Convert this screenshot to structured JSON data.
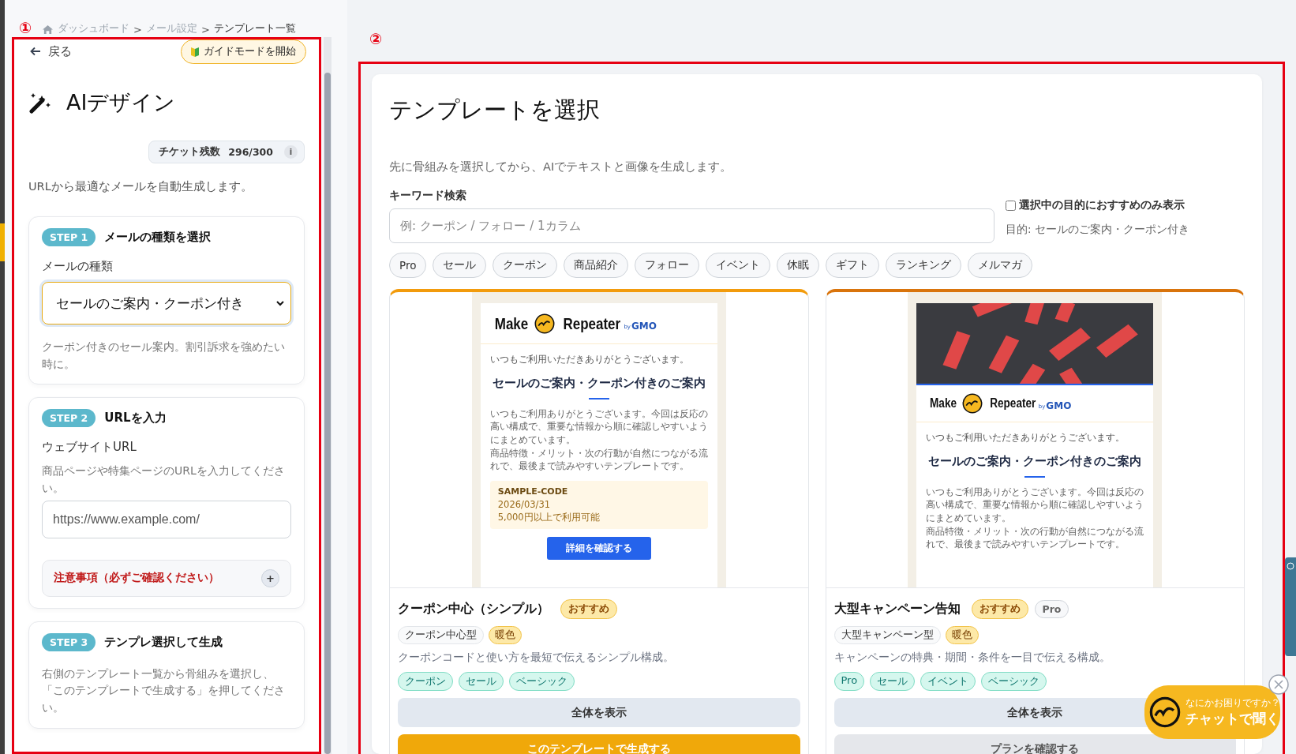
{
  "annotations": [
    {
      "label": "①"
    },
    {
      "label": "②"
    }
  ],
  "breadcrumb": {
    "separator": ">",
    "items": [
      {
        "label": "ダッシュボード",
        "current": false
      },
      {
        "label": "メール設定",
        "current": false
      },
      {
        "label": "テンプレート一覧",
        "current": true
      }
    ]
  },
  "sidebar": {
    "back": "戻る",
    "guide_button": "ガイドモードを開始",
    "title": "AIデザイン",
    "ticket": {
      "label": "チケット残数",
      "value": "296/300",
      "info": "i"
    },
    "intro": "URLから最適なメールを自動生成します。",
    "steps": [
      {
        "kind": "select",
        "badge": "STEP 1",
        "title": "メールの種類を選択",
        "field_label": "メールの種類",
        "value": "セールのご案内・クーポン付き",
        "note": "クーポン付きのセール案内。割引訴求を強めたい時に。"
      },
      {
        "kind": "url",
        "badge": "STEP 2",
        "title": "URLを入力",
        "field_label": "ウェブサイトURL",
        "note": "商品ページや特集ページのURLを入力してください。",
        "placeholder": "https://www.example.com/",
        "notice": {
          "label": "注意事項（必ずご確認ください）",
          "toggle": "+"
        }
      },
      {
        "kind": "text",
        "badge": "STEP 3",
        "title": "テンプレ選択して生成",
        "note": "右側のテンプレート一覧から骨組みを選択し、「このテンプレートで生成する」を押してください。"
      }
    ]
  },
  "main": {
    "title": "テンプレートを選択",
    "subtitle": "先に骨組みを選択してから、AIでテキストと画像を生成します。",
    "search_label": "キーワード検索",
    "search_placeholder": "例: クーポン / フォロー / 1カラム",
    "recommend_filter": {
      "label": "選択中の目的におすすめのみ表示",
      "checked": false
    },
    "purpose": "目的: セールのご案内・クーポン付き",
    "chips": [
      "Pro",
      "セール",
      "クーポン",
      "商品紹介",
      "フォロー",
      "イベント",
      "休眠",
      "ギフト",
      "ランキング",
      "メルマガ"
    ],
    "templates": [
      {
        "preview": {
          "kind": "logo-top",
          "logo": {
            "make": "Make",
            "repeater": "Repeater",
            "by": "by",
            "maker": "GMO"
          },
          "greeting": "いつもご利用いただきありがとうございます。",
          "headline": "セールのご案内・クーポン付きのご案内",
          "body": [
            "いつもご利用ありがとうございます。今回は反応の高い構成で、重要な情報から順に確認しやすいようにまとめています。",
            "商品特徴・メリット・次の行動が自然につながる流れで、最後まで読みやすいテンプレートです。"
          ],
          "coupon": {
            "code": "SAMPLE-CODE",
            "date": "2026/03/31",
            "condition": "5,000円以上で利用可能"
          },
          "cta": "詳細を確認する"
        },
        "name": "クーポン中心（シンプル）",
        "badges": [
          {
            "kind": "recommend",
            "label": "おすすめ"
          }
        ],
        "type_tag": "クーポン中心型",
        "tone_tag": "暖色",
        "description": "クーポンコードと使い方を最短で伝えるシンプル構成。",
        "tags": [
          "クーポン",
          "セール",
          "ベーシック"
        ],
        "view_button": "全体を表示",
        "action": {
          "kind": "generate",
          "label": "このテンプレートで生成する"
        }
      },
      {
        "preview": {
          "kind": "hero-photo",
          "logo": {
            "make": "Make",
            "repeater": "Repeater",
            "by": "by",
            "maker": "GMO"
          },
          "greeting": "いつもご利用いただきありがとうございます。",
          "headline": "セールのご案内・クーポン付きのご案内",
          "body": [
            "いつもご利用ありがとうございます。今回は反応の高い構成で、重要な情報から順に確認しやすいようにまとめています。",
            "商品特徴・メリット・次の行動が自然につながる流れで、最後まで読みやすいテンプレートです。"
          ]
        },
        "name": "大型キャンペーン告知",
        "badges": [
          {
            "kind": "recommend",
            "label": "おすすめ"
          },
          {
            "kind": "pro",
            "label": "Pro"
          }
        ],
        "type_tag": "大型キャンペーン型",
        "tone_tag": "暖色",
        "description": "キャンペーンの特典・期間・条件を一目で伝える構成。",
        "tags": [
          "Pro",
          "セール",
          "イベント",
          "ベーシック"
        ],
        "view_button": "全体を表示",
        "action": {
          "kind": "plan",
          "label": "プランを確認する"
        }
      }
    ]
  },
  "chat": {
    "question": "なにかお困りですか？",
    "action": "チャットで聞く"
  }
}
